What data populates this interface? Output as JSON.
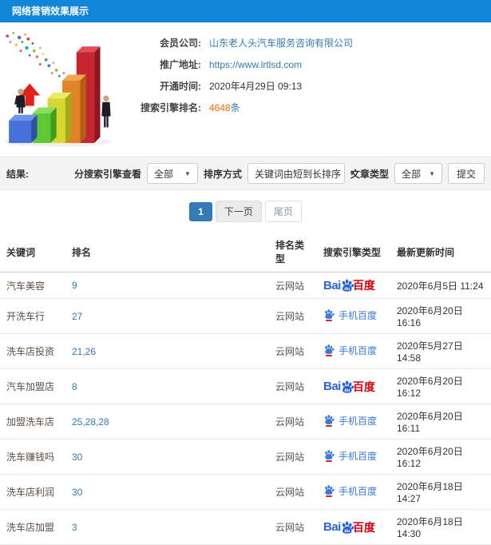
{
  "header": {
    "title": "网络营销效果展示"
  },
  "info": {
    "company_label": "会员公司:",
    "company_value": "山东老人头汽车服务咨询有限公司",
    "url_label": "推广地址:",
    "url_value": "https://www.lrtlsd.com",
    "open_time_label": "开通时间:",
    "open_time_value": "2020年4月29日 09:13",
    "rank_count_label": "搜索引擎排名:",
    "rank_count_value": "4648",
    "rank_count_unit": "条"
  },
  "filters": {
    "result_label": "结果:",
    "engine_label": "分搜索引擎查看",
    "engine_value": "全部",
    "sort_label": "排序方式",
    "sort_value": "关键词由短到长排序",
    "article_label": "文章类型",
    "article_value": "全部",
    "submit_label": "提交"
  },
  "pagination": {
    "current": "1",
    "next": "下一页",
    "last": "尾页"
  },
  "logos": {
    "baidu_pc": {
      "bai": "Bai",
      "du": "du",
      "cn": "百度"
    },
    "baidu_mobile": {
      "label": "手机百度"
    }
  },
  "table": {
    "headers": [
      "关键词",
      "排名",
      "排名类型",
      "搜索引擎类型",
      "最新更新时间"
    ],
    "rows": [
      {
        "keyword": "汽车美容",
        "rank": "9",
        "rank_type": "云网站",
        "engine": "baidu-pc",
        "updated": "2020年6月5日 11:24"
      },
      {
        "keyword": "开洗车行",
        "rank": "27",
        "rank_type": "云网站",
        "engine": "baidu-mobile",
        "updated": "2020年6月20日 16:16"
      },
      {
        "keyword": "洗车店投资",
        "rank": "21,26",
        "rank_type": "云网站",
        "engine": "baidu-mobile",
        "updated": "2020年5月27日 14:58"
      },
      {
        "keyword": "汽车加盟店",
        "rank": "8",
        "rank_type": "云网站",
        "engine": "baidu-pc",
        "updated": "2020年6月20日 16:12"
      },
      {
        "keyword": "加盟洗车店",
        "rank": "25,28,28",
        "rank_type": "云网站",
        "engine": "baidu-mobile",
        "updated": "2020年6月20日 16:11"
      },
      {
        "keyword": "洗车赚钱吗",
        "rank": "30",
        "rank_type": "云网站",
        "engine": "baidu-mobile",
        "updated": "2020年6月20日 16:12"
      },
      {
        "keyword": "洗车店利润",
        "rank": "30",
        "rank_type": "云网站",
        "engine": "baidu-mobile",
        "updated": "2020年6月18日 14:27"
      },
      {
        "keyword": "洗车店加盟",
        "rank": "3",
        "rank_type": "云网站",
        "engine": "baidu-pc",
        "updated": "2020年6月18日 14:30"
      }
    ]
  },
  "colors": {
    "header_blue": "#1286d8",
    "link_blue": "#337ab7",
    "count_orange": "#ff6600",
    "baidu_blue": "#2a62d9",
    "baidu_red": "#d7000f",
    "filter_bg": "#f4f4f4"
  }
}
